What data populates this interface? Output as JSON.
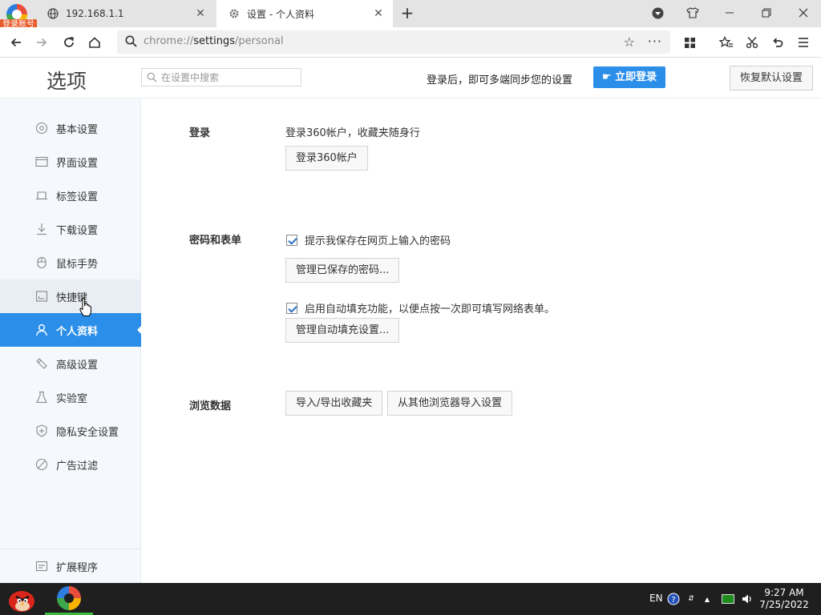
{
  "tabs": [
    {
      "title": "192.168.1.1",
      "icon": "globe-icon"
    },
    {
      "title": "设置 - 个人资料",
      "icon": "gear-icon"
    }
  ],
  "login_badge": "登录账号",
  "address": {
    "scheme": "chrome://",
    "host": "settings",
    "path": "/personal"
  },
  "header": {
    "title": "选项",
    "search_placeholder": "在设置中搜索",
    "sync_text": "登录后，即可多端同步您的设置",
    "login_now": "立即登录",
    "restore_defaults": "恢复默认设置"
  },
  "sidebar": {
    "items": [
      {
        "label": "基本设置",
        "icon": "basic-settings-icon"
      },
      {
        "label": "界面设置",
        "icon": "interface-icon"
      },
      {
        "label": "标签设置",
        "icon": "tab-icon"
      },
      {
        "label": "下载设置",
        "icon": "download-icon"
      },
      {
        "label": "鼠标手势",
        "icon": "mouse-icon"
      },
      {
        "label": "快捷键",
        "icon": "keyboard-icon"
      },
      {
        "label": "个人资料",
        "icon": "user-icon"
      },
      {
        "label": "高级设置",
        "icon": "advanced-icon"
      },
      {
        "label": "实验室",
        "icon": "flask-icon"
      },
      {
        "label": "隐私安全设置",
        "icon": "shield-icon"
      },
      {
        "label": "广告过滤",
        "icon": "block-icon"
      }
    ],
    "extensions": "扩展程序"
  },
  "content": {
    "login": {
      "label": "登录",
      "desc": "登录360帐户，收藏夹随身行",
      "button": "登录360帐户"
    },
    "password": {
      "label": "密码和表单",
      "offer_save": {
        "label": "提示我保存在网页上输入的密码",
        "checked": true
      },
      "manage_passwords": "管理已保存的密码...",
      "autofill": {
        "label": "启用自动填充功能，以便点按一次即可填写网络表单。",
        "checked": true
      },
      "manage_autofill": "管理自动填充设置..."
    },
    "browsing": {
      "label": "浏览数据",
      "import_export": "导入/导出收藏夹",
      "import_other": "从其他浏览器导入设置"
    }
  },
  "taskbar": {
    "lang": "EN",
    "time": "9:27 AM",
    "date": "7/25/2022"
  },
  "colors": {
    "accent": "#2b8ee8",
    "sidebar_bg": "#f5f8fc",
    "taskbar_bg": "#1f1f1f"
  }
}
